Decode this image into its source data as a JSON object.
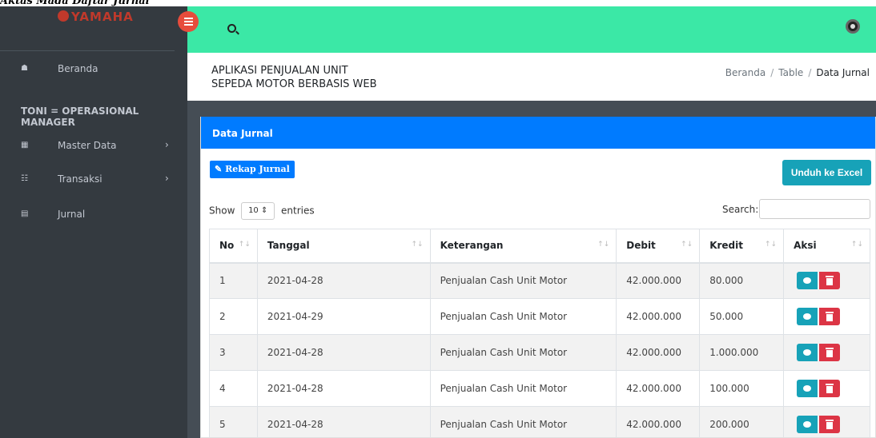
{
  "caption": "Aktas Mada Daftar Jurnal",
  "brand": {
    "name": "YAMAHA"
  },
  "sidebar": {
    "items": [
      {
        "label": "Beranda",
        "icon": "home-icon"
      },
      {
        "label": "Master Data",
        "icon": "table-icon"
      },
      {
        "label": "Transaksi",
        "icon": "cart-icon"
      },
      {
        "label": "Jurnal",
        "icon": "journal-icon"
      }
    ],
    "user_header": "TONI = OPERASIONAL MANAGER"
  },
  "header": {
    "title_line1": "APLIKASI PENJUALAN UNIT",
    "title_line2": "SEPEDA MOTOR BERBASIS WEB",
    "breadcrumb": [
      "Beranda",
      "Table",
      "Data Jurnal"
    ]
  },
  "card": {
    "title": "Data Jurnal",
    "rekap_label": "Rekap Jurnal",
    "excel_label": "Unduh ke Excel",
    "show_label": "Show",
    "entries_value": "10",
    "entries_label": "entries",
    "search_label": "Search:",
    "search_value": ""
  },
  "table": {
    "columns": [
      "No",
      "Tanggal",
      "Keterangan",
      "Debit",
      "Kredit",
      "Aksi"
    ],
    "rows": [
      [
        "1",
        "2021-04-28",
        "Penjualan Cash Unit Motor",
        "42.000.000",
        "80.000"
      ],
      [
        "2",
        "2021-04-29",
        "Penjualan Cash Unit Motor",
        "42.000.000",
        "50.000"
      ],
      [
        "3",
        "2021-04-28",
        "Penjualan Cash Unit Motor",
        "42.000.000",
        "1.000.000"
      ],
      [
        "4",
        "2021-04-28",
        "Penjualan Cash Unit Motor",
        "42.000.000",
        "100.000"
      ],
      [
        "5",
        "2021-04-28",
        "Penjualan Cash Unit Motor",
        "42.000.000",
        "200.000"
      ]
    ]
  },
  "colors": {
    "topbar": "#3be8a6",
    "sidebar": "#343a40",
    "primary": "#007bff",
    "info": "#17a2b8",
    "danger": "#dc3545"
  }
}
